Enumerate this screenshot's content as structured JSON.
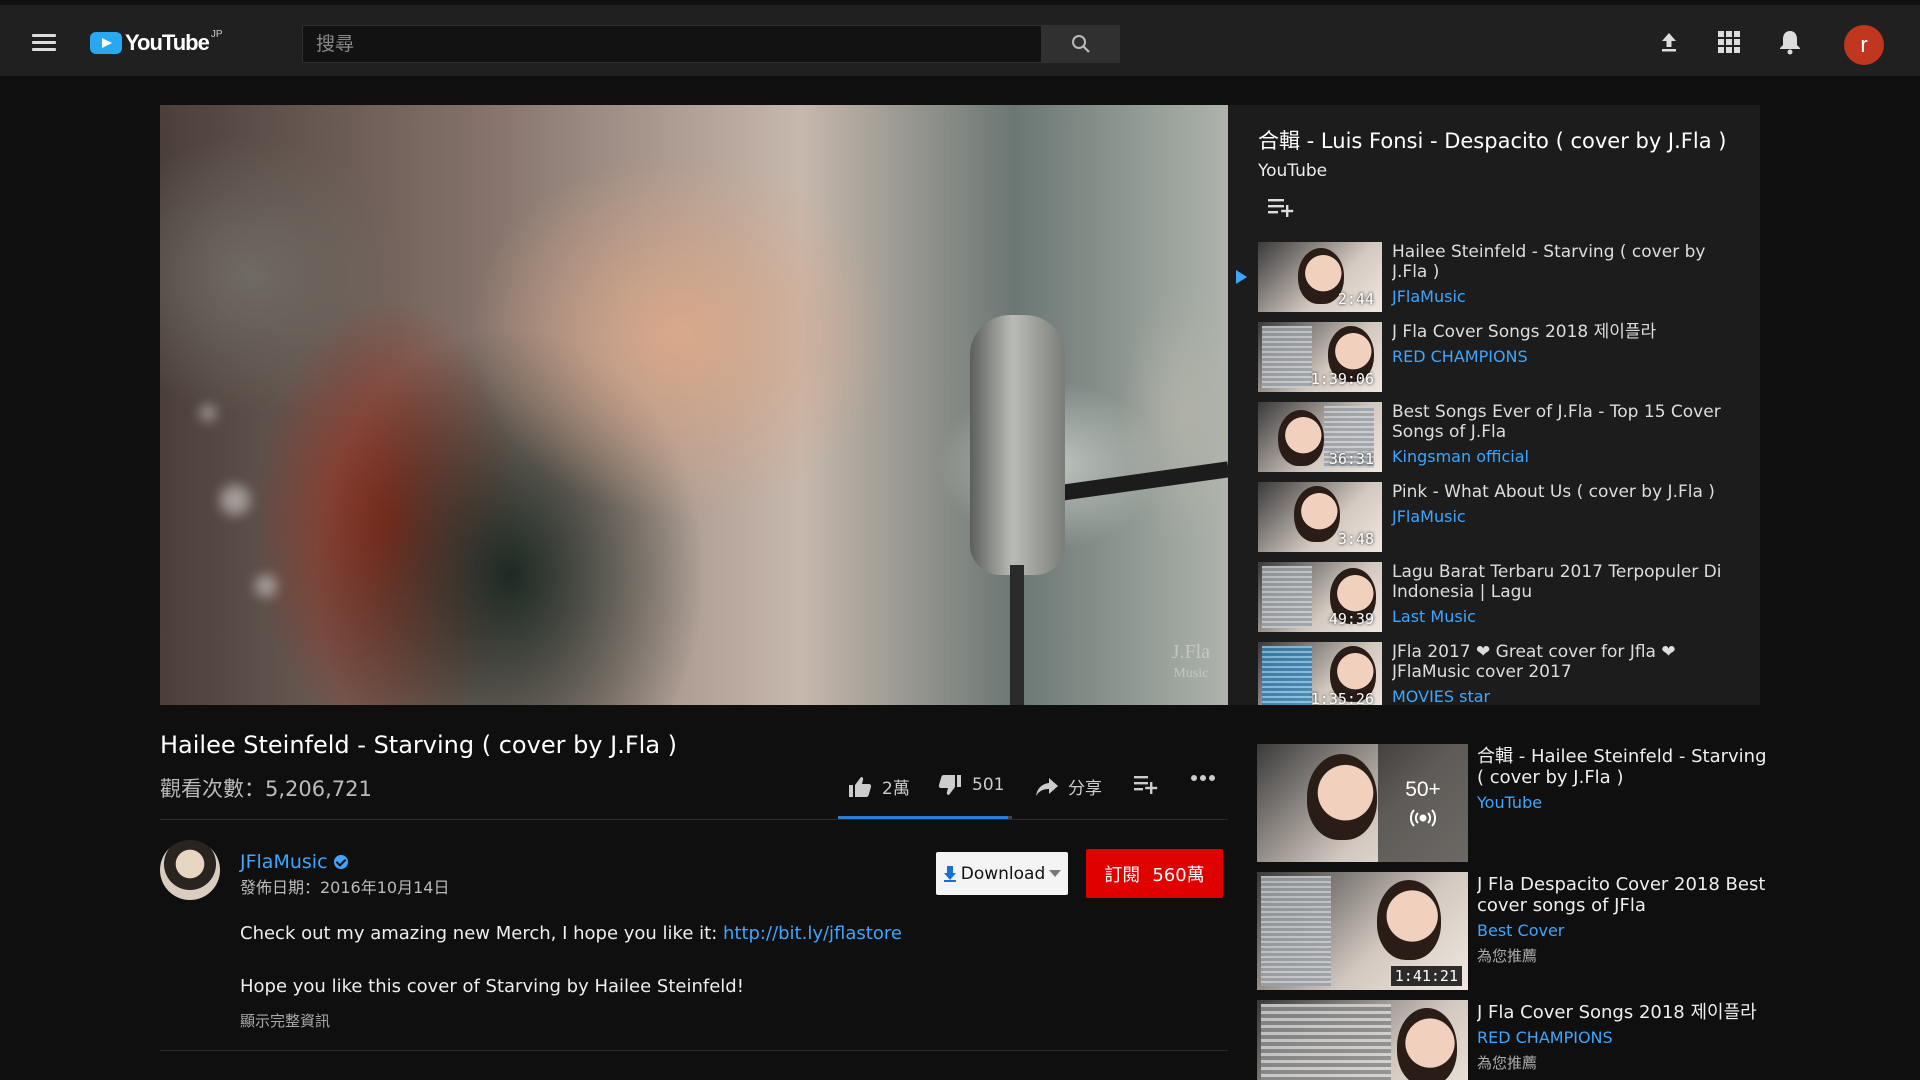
{
  "topbar": {
    "logo_text": "YouTube",
    "logo_region": "JP",
    "search_placeholder": "搜尋",
    "avatar_letter": "r",
    "icons": [
      "menu-icon",
      "search-icon",
      "upload-icon",
      "apps-icon",
      "notifications-icon"
    ]
  },
  "video": {
    "title": "Hailee Steinfeld - Starving ( cover by J.Fla )",
    "views": "觀看次數：5,206,721",
    "watermark_line1": "J.Fla",
    "watermark_line2": "Music",
    "likes": "2萬",
    "dislikes": "501",
    "share_label": "分享",
    "like_ratio": 0.976
  },
  "channel": {
    "name": "JFlaMusic",
    "publish_date": "發佈日期：2016年10月14日",
    "download_label": "Download",
    "subscribe_label": "訂閱",
    "subscriber_count": "560萬"
  },
  "description": {
    "line1_text": "Check out my amazing new Merch, I hope you like it: ",
    "line1_link": "http://bit.ly/jflastore",
    "line2": "Hope you like this cover of Starving by Hailee Steinfeld!",
    "show_more": "顯示完整資訊"
  },
  "playlist": {
    "title": "合輯 - Luis Fonsi - Despacito ( cover by J.Fla )",
    "subtitle": "YouTube",
    "items": [
      {
        "title": "Hailee Steinfeld - Starving ( cover by J.Fla )",
        "channel": "JFlaMusic",
        "duration": "2:44",
        "current": true
      },
      {
        "title": "J Fla Cover Songs 2018 제이플라",
        "channel": "RED CHAMPIONS",
        "duration": "1:39:06",
        "current": false
      },
      {
        "title": "Best Songs Ever of J.Fla - Top 15 Cover Songs of J.Fla",
        "channel": "Kingsman official",
        "duration": "36:31",
        "current": false
      },
      {
        "title": "Pink - What About Us ( cover by J.Fla )",
        "channel": "JFlaMusic",
        "duration": "3:48",
        "current": false
      },
      {
        "title": "Lagu Barat Terbaru 2017 Terpopuler Di Indonesia | Lagu",
        "channel": "Last Music",
        "duration": "49:39",
        "current": false
      },
      {
        "title": "JFla 2017 ❤ Great cover for Jfla ❤ JFlaMusic cover 2017",
        "channel": "MOVIES star",
        "duration": "1:35:26",
        "current": false
      }
    ]
  },
  "recommendations": [
    {
      "title": "合輯 - Hailee Steinfeld - Starving ( cover by J.Fla )",
      "channel": "YouTube",
      "meta": "",
      "mix_count": "50+",
      "duration": ""
    },
    {
      "title": "J Fla Despacito Cover 2018 Best cover songs of JFla",
      "channel": "Best Cover",
      "meta": "為您推薦",
      "mix_count": "",
      "duration": "1:41:21"
    },
    {
      "title": "J Fla Cover Songs 2018 제이플라",
      "channel": "RED CHAMPIONS",
      "meta": "為您推薦",
      "mix_count": "",
      "duration": ""
    }
  ]
}
